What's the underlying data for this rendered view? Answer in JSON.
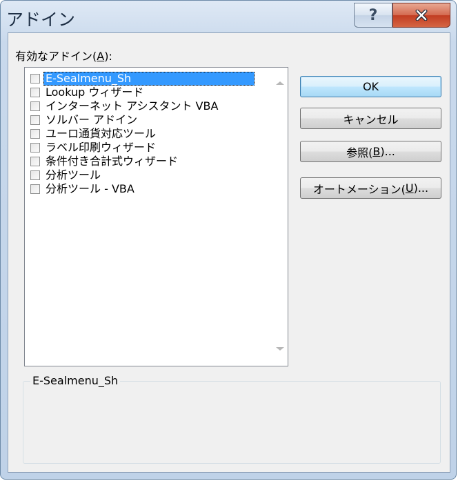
{
  "window": {
    "title": "アドイン",
    "help_glyph": "?",
    "close_glyph": "✕"
  },
  "list_label": {
    "text": "有効なアドイン(",
    "mnemonic": "A",
    "suffix": "):"
  },
  "addins": [
    {
      "label": "E-Sealmenu_Sh",
      "checked": false,
      "selected": true
    },
    {
      "label": "Lookup ウィザード",
      "checked": false,
      "selected": false
    },
    {
      "label": "インターネット アシスタント VBA",
      "checked": false,
      "selected": false
    },
    {
      "label": "ソルバー アドイン",
      "checked": false,
      "selected": false
    },
    {
      "label": "ユーロ通貨対応ツール",
      "checked": false,
      "selected": false
    },
    {
      "label": "ラベル印刷ウィザード",
      "checked": false,
      "selected": false
    },
    {
      "label": "条件付き合計式ウィザード",
      "checked": false,
      "selected": false
    },
    {
      "label": "分析ツール",
      "checked": false,
      "selected": false
    },
    {
      "label": "分析ツール - VBA",
      "checked": false,
      "selected": false
    }
  ],
  "buttons": {
    "ok": "OK",
    "cancel": "キャンセル",
    "browse": {
      "pre": "参照(",
      "key": "B",
      "post": ")..."
    },
    "automation": {
      "pre": "オートメーション(",
      "key": "U",
      "post": ")..."
    }
  },
  "description": {
    "title": "E-Sealmenu_Sh",
    "text": ""
  }
}
